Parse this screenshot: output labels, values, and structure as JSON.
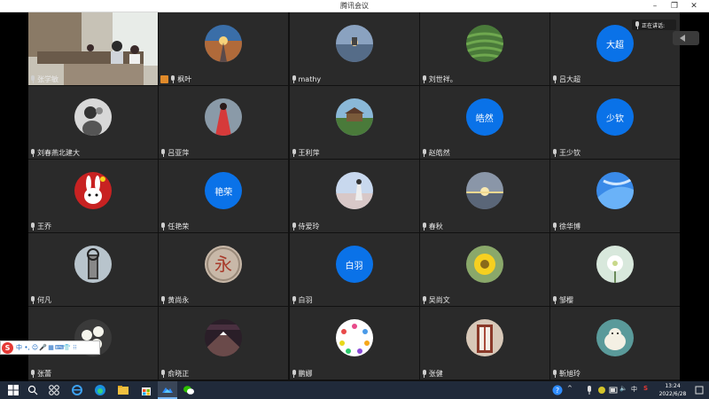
{
  "window": {
    "title": "腾讯会议",
    "minimize_glyph": "–",
    "restore_glyph": "❐",
    "close_glyph": "✕"
  },
  "speaking_indicator": "正在讲话:",
  "participants": [
    {
      "name": "张学敏",
      "avatar": "video-feed"
    },
    {
      "name": "枫叶",
      "avatar": "road-sunset-photo"
    },
    {
      "name": "mathy",
      "avatar": "lake-sunset-photo"
    },
    {
      "name": "刘世祥。",
      "avatar": "tea-field-photo"
    },
    {
      "name": "吕大超",
      "avatar": "text",
      "avatar_text": "大超"
    },
    {
      "name": "刘春燕北建大",
      "avatar": "girl-bw-photo"
    },
    {
      "name": "吕亚萍",
      "avatar": "red-dress-photo"
    },
    {
      "name": "王利萍",
      "avatar": "landscape-photo"
    },
    {
      "name": "赵皓然",
      "avatar": "text",
      "avatar_text": "皓然"
    },
    {
      "name": "王少钦",
      "avatar": "text",
      "avatar_text": "少钦"
    },
    {
      "name": "王乔",
      "avatar": "rabbit-photo"
    },
    {
      "name": "任艳荣",
      "avatar": "text",
      "avatar_text": "艳荣"
    },
    {
      "name": "侍爱玲",
      "avatar": "beach-girl-photo"
    },
    {
      "name": "春秋",
      "avatar": "sea-sunset-photo"
    },
    {
      "name": "徐华博",
      "avatar": "blue-sky-photo"
    },
    {
      "name": "何凡",
      "avatar": "tower-photo"
    },
    {
      "name": "黄尚永",
      "avatar": "calligraphy-photo"
    },
    {
      "name": "白羽",
      "avatar": "text",
      "avatar_text": "白羽"
    },
    {
      "name": "吴尚文",
      "avatar": "flower-photo"
    },
    {
      "name": "邹樱",
      "avatar": "white-flower-photo"
    },
    {
      "name": "张蕾",
      "avatar": "white-blossom-photo"
    },
    {
      "name": "俞晓正",
      "avatar": "mountain-photo"
    },
    {
      "name": "鹏娜",
      "avatar": "butterflies-photo"
    },
    {
      "name": "张健",
      "avatar": "door-photo"
    },
    {
      "name": "靳旭玲",
      "avatar": "polar-bear-photo"
    }
  ],
  "ime_toolbar": {
    "logo": "S",
    "keys": [
      "中",
      "•,",
      "☺",
      "🎤",
      "▦",
      "⌨",
      "👕",
      "⁝⁝"
    ]
  },
  "taskbar": {
    "icons": [
      "windows-start-icon",
      "search-icon",
      "task-view-icon",
      "ie-icon",
      "edge-icon",
      "file-explorer-icon",
      "store-icon",
      "tencent-meeting-icon",
      "wechat-icon"
    ],
    "tray": {
      "chevron": "^",
      "speaker": "🔈",
      "ime": "中",
      "app": "S"
    },
    "time": "13:24",
    "date": "2022/6/28"
  }
}
